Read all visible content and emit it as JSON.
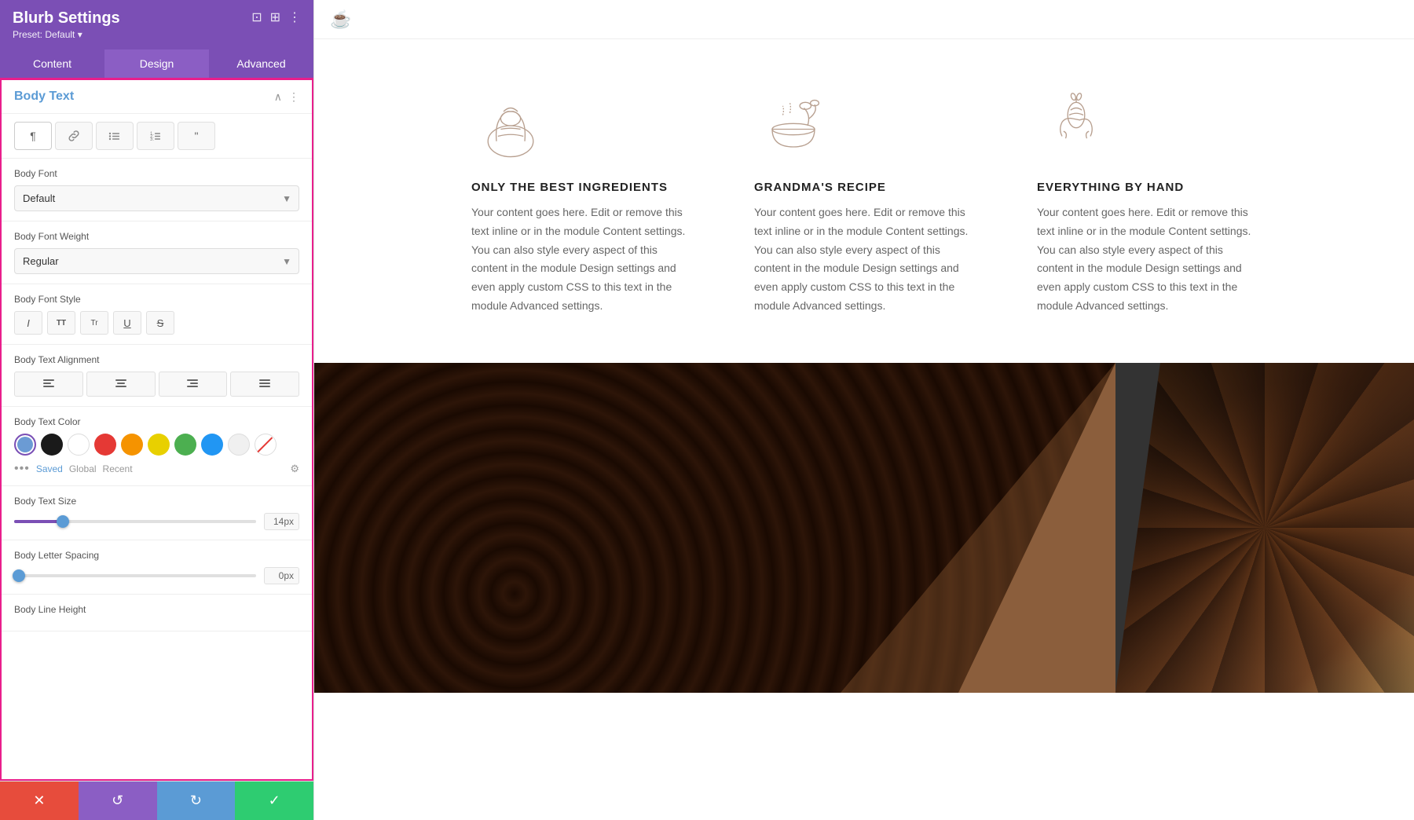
{
  "sidebar": {
    "title": "Blurb Settings",
    "preset": "Preset: Default ▾",
    "tabs": [
      {
        "id": "content",
        "label": "Content",
        "active": false
      },
      {
        "id": "design",
        "label": "Design",
        "active": true
      },
      {
        "id": "advanced",
        "label": "Advanced",
        "active": false
      }
    ],
    "section": {
      "title": "Body Text",
      "text_style_buttons": [
        {
          "id": "paragraph",
          "symbol": "¶"
        },
        {
          "id": "link",
          "symbol": "⊘"
        },
        {
          "id": "ul",
          "symbol": "≡"
        },
        {
          "id": "ol",
          "symbol": "≣"
        },
        {
          "id": "quote",
          "symbol": "❝"
        }
      ],
      "body_font": {
        "label": "Body Font",
        "value": "Default"
      },
      "body_font_weight": {
        "label": "Body Font Weight",
        "value": "Regular"
      },
      "body_font_style": {
        "label": "Body Font Style",
        "buttons": [
          "I",
          "TT",
          "Tr",
          "U",
          "S"
        ]
      },
      "body_text_alignment": {
        "label": "Body Text Alignment",
        "buttons": [
          "align-left",
          "align-center",
          "align-right",
          "align-justify"
        ]
      },
      "body_text_color": {
        "label": "Body Text Color",
        "swatches": [
          {
            "color": "#6b9bd4",
            "active": true
          },
          {
            "color": "#1a1a1a"
          },
          {
            "color": "#ffffff"
          },
          {
            "color": "#e53935"
          },
          {
            "color": "#f59300"
          },
          {
            "color": "#e8d000"
          },
          {
            "color": "#4caf50"
          },
          {
            "color": "#2196f3"
          },
          {
            "color": "#f5f5f5"
          },
          {
            "color": "transparent",
            "strikethrough": true
          }
        ],
        "tabs": [
          "Saved",
          "Global",
          "Recent"
        ],
        "active_tab": "Saved"
      },
      "body_text_size": {
        "label": "Body Text Size",
        "value": "14px",
        "percent": 20
      },
      "body_letter_spacing": {
        "label": "Body Letter Spacing",
        "value": "0px",
        "percent": 2
      },
      "body_line_height": {
        "label": "Body Line Height"
      }
    },
    "bottom_bar": {
      "cancel": "✕",
      "undo": "↺",
      "redo": "↻",
      "save": "✓"
    }
  },
  "main": {
    "blurbs": [
      {
        "heading": "ONLY THE BEST INGREDIENTS",
        "text": "Your content goes here. Edit or remove this text inline or in the module Content settings. You can also style every aspect of this content in the module Design settings and even apply custom CSS to this text in the module Advanced settings."
      },
      {
        "heading": "GRANDMA'S RECIPE",
        "text": "Your content goes here. Edit or remove this text inline or in the module Content settings. You can also style every aspect of this content in the module Design settings and even apply custom CSS to this text in the module Advanced settings."
      },
      {
        "heading": "EVERYTHING BY HAND",
        "text": "Your content goes here. Edit or remove this text inline or in the module Content settings. You can also style every aspect of this content in the module Design settings and even apply custom CSS to this text in the module Advanced settings."
      }
    ]
  }
}
